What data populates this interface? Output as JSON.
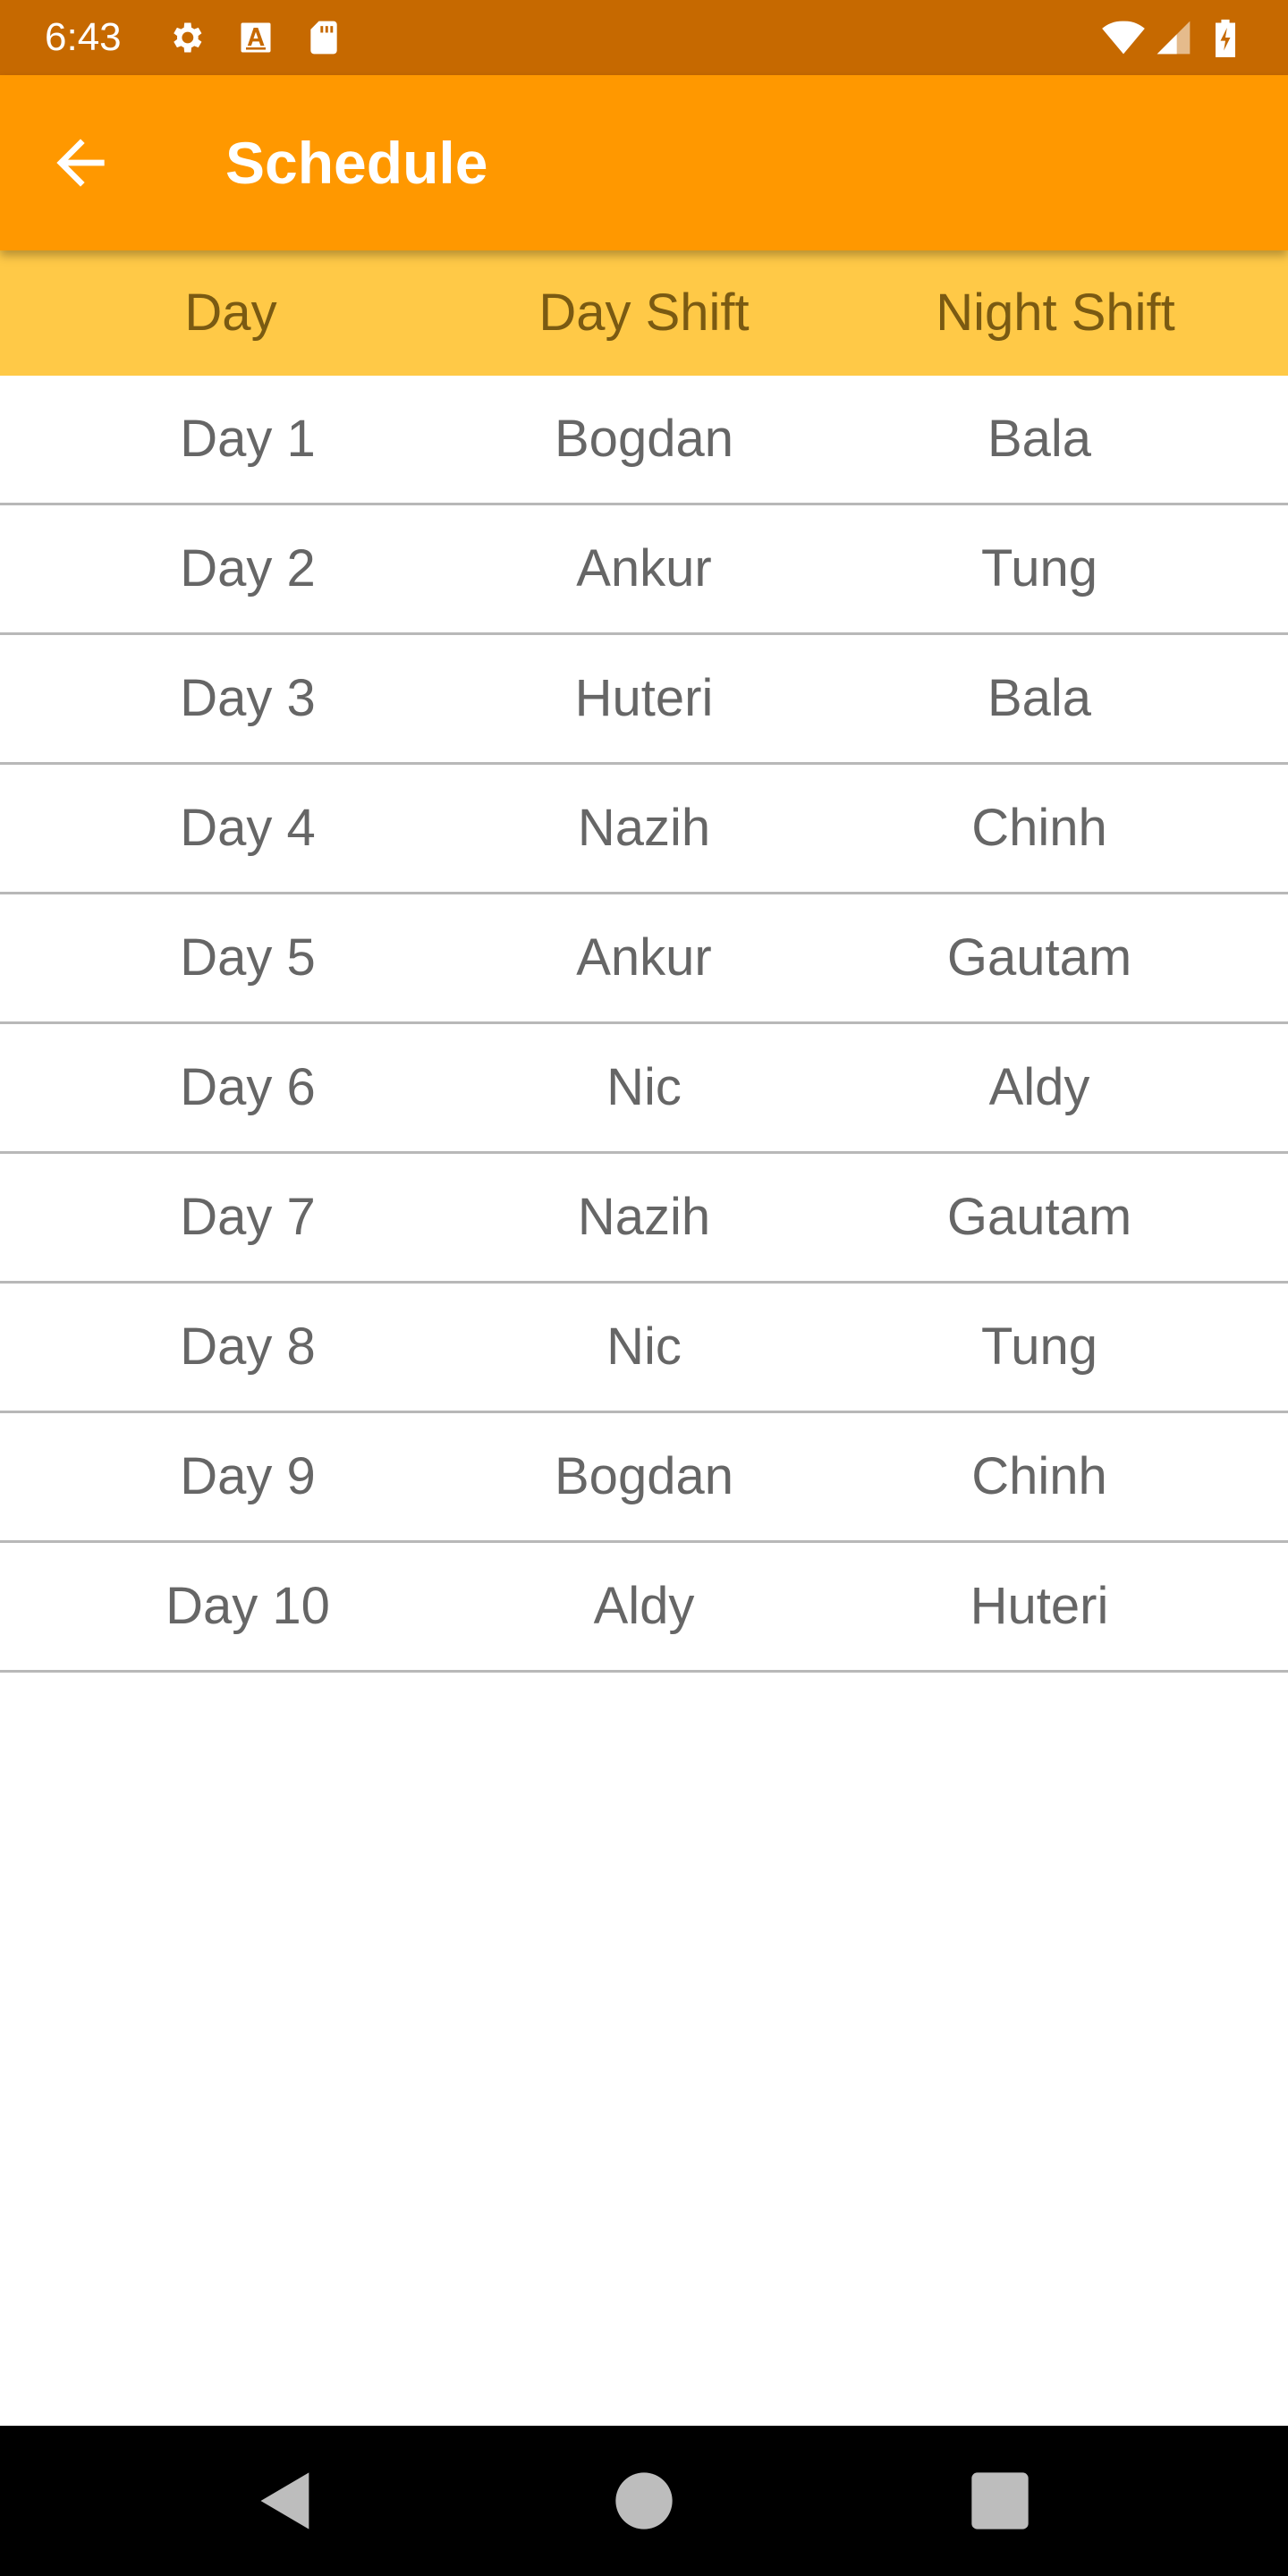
{
  "status_bar": {
    "time": "6:43",
    "icons": [
      "gear-icon",
      "font-a-icon",
      "sd-card-icon",
      "wifi-icon",
      "signal-icon",
      "battery-charging-icon"
    ]
  },
  "app_bar": {
    "title": "Schedule",
    "back_icon": "arrow-back-icon",
    "color": "#ff9800"
  },
  "table": {
    "header_color": "#ffc947",
    "headers": {
      "day": "Day",
      "day_shift": "Day Shift",
      "night_shift": "Night Shift"
    },
    "rows": [
      {
        "day": "Day 1",
        "day_shift": "Bogdan",
        "night_shift": "Bala"
      },
      {
        "day": "Day 2",
        "day_shift": "Ankur",
        "night_shift": "Tung"
      },
      {
        "day": "Day 3",
        "day_shift": "Huteri",
        "night_shift": "Bala"
      },
      {
        "day": "Day 4",
        "day_shift": "Nazih",
        "night_shift": "Chinh"
      },
      {
        "day": "Day 5",
        "day_shift": "Ankur",
        "night_shift": "Gautam"
      },
      {
        "day": "Day 6",
        "day_shift": "Nic",
        "night_shift": "Aldy"
      },
      {
        "day": "Day 7",
        "day_shift": "Nazih",
        "night_shift": "Gautam"
      },
      {
        "day": "Day 8",
        "day_shift": "Nic",
        "night_shift": "Tung"
      },
      {
        "day": "Day 9",
        "day_shift": "Bogdan",
        "night_shift": "Chinh"
      },
      {
        "day": "Day 10",
        "day_shift": "Aldy",
        "night_shift": "Huteri"
      }
    ]
  },
  "nav_bar": {
    "icons": [
      "nav-back-icon",
      "nav-home-icon",
      "nav-recents-icon"
    ]
  }
}
